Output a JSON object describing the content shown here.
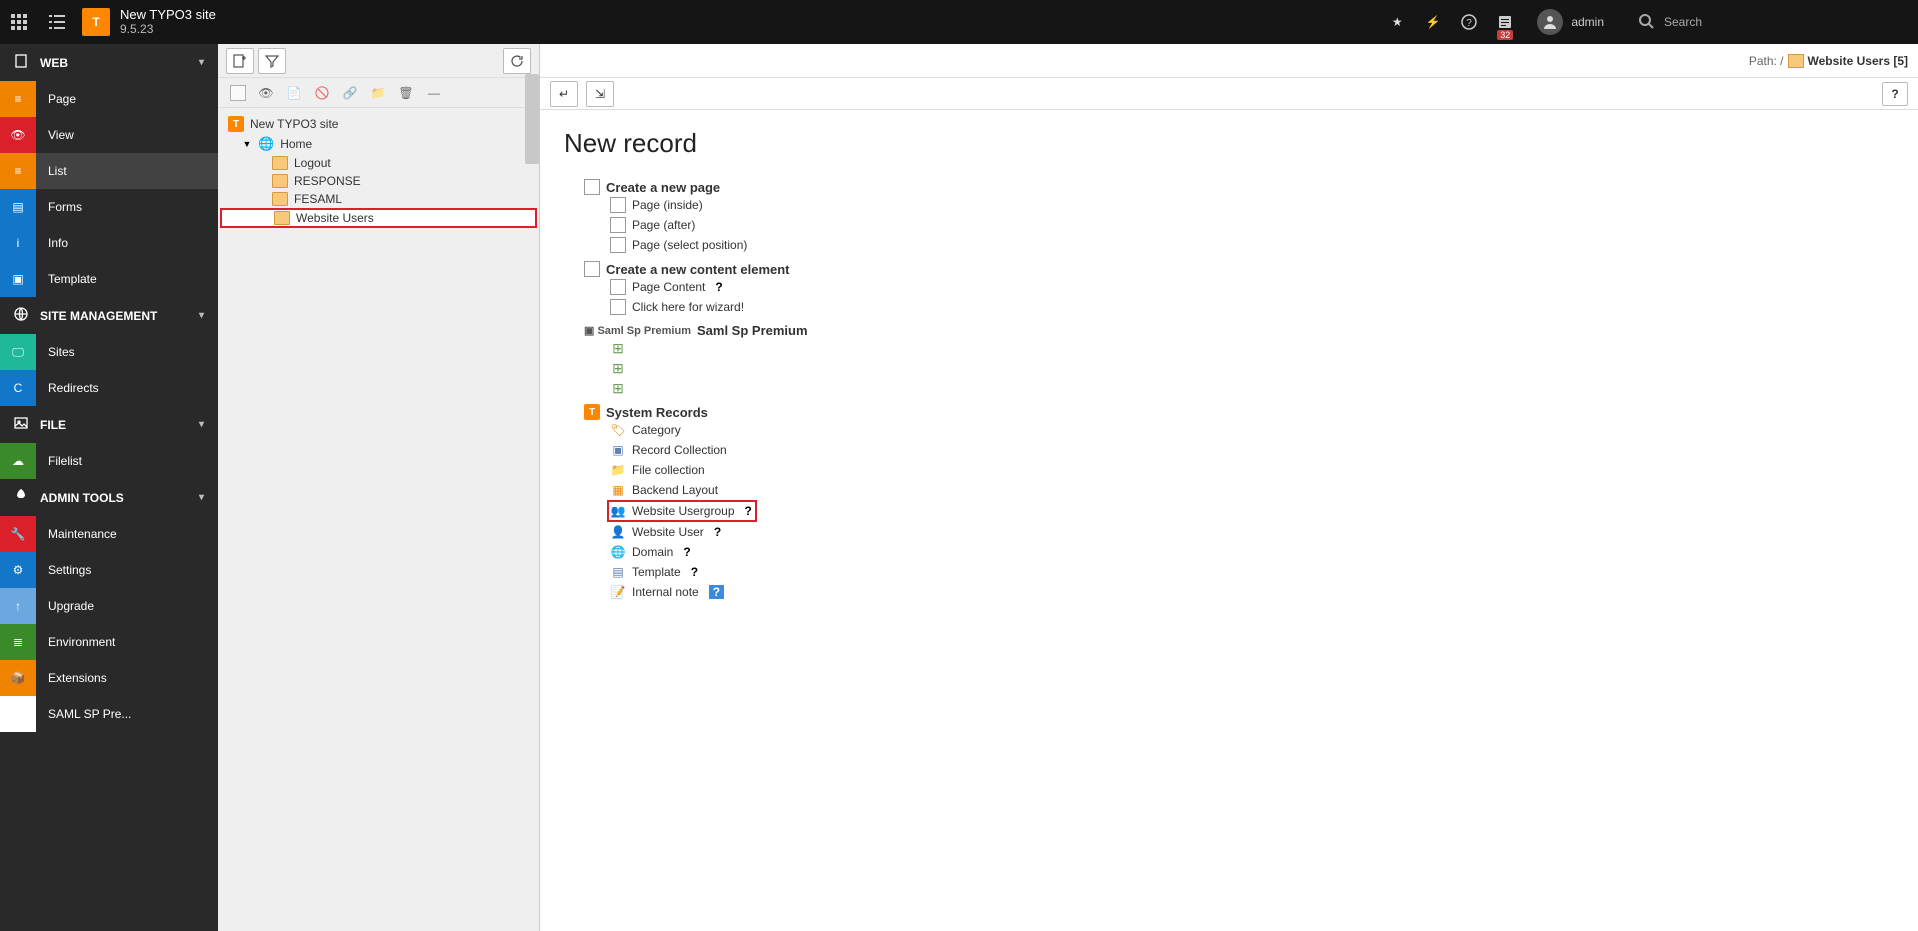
{
  "topbar": {
    "site_title": "New TYPO3 site",
    "version": "9.5.23",
    "notification_count": "32",
    "username": "admin",
    "search_label": "Search"
  },
  "modmenu": {
    "groups": [
      {
        "label": "WEB",
        "icon": "doc",
        "items": [
          {
            "label": "Page",
            "cls": "sq-page",
            "icon": "≡"
          },
          {
            "label": "View",
            "cls": "sq-view",
            "icon": "👁"
          },
          {
            "label": "List",
            "cls": "sq-list",
            "icon": "≡",
            "active": true
          },
          {
            "label": "Forms",
            "cls": "sq-forms",
            "icon": "▤"
          },
          {
            "label": "Info",
            "cls": "sq-info",
            "icon": "i"
          },
          {
            "label": "Template",
            "cls": "sq-template",
            "icon": "▣"
          }
        ]
      },
      {
        "label": "SITE MANAGEMENT",
        "icon": "globe",
        "items": [
          {
            "label": "Sites",
            "cls": "sq-sites",
            "icon": "🖵"
          },
          {
            "label": "Redirects",
            "cls": "sq-redirects",
            "icon": "C"
          }
        ]
      },
      {
        "label": "FILE",
        "icon": "image",
        "items": [
          {
            "label": "Filelist",
            "cls": "sq-filelist",
            "icon": "☁"
          }
        ]
      },
      {
        "label": "ADMIN TOOLS",
        "icon": "rocket",
        "items": [
          {
            "label": "Maintenance",
            "cls": "sq-maint",
            "icon": "🔧"
          },
          {
            "label": "Settings",
            "cls": "sq-settings",
            "icon": "⚙"
          },
          {
            "label": "Upgrade",
            "cls": "sq-upgrade",
            "icon": "↑"
          },
          {
            "label": "Environment",
            "cls": "sq-env",
            "icon": "≣"
          },
          {
            "label": "Extensions",
            "cls": "sq-ext",
            "icon": "📦"
          },
          {
            "label": "SAML SP Pre...",
            "cls": "sq-saml",
            "icon": "◐"
          }
        ]
      }
    ]
  },
  "pagetree": {
    "root": "New TYPO3 site",
    "home": "Home",
    "children": [
      {
        "label": "Logout"
      },
      {
        "label": "RESPONSE"
      },
      {
        "label": "FESAML"
      },
      {
        "label": "Website Users",
        "highlight": true
      }
    ]
  },
  "main": {
    "path_prefix": "Path: /",
    "path_label": "Website Users [5]",
    "heading": "New record",
    "tree": {
      "create_page": {
        "label": "Create a new page",
        "items": [
          {
            "label": "Page (inside)"
          },
          {
            "label": "Page (after)"
          },
          {
            "label": "Page (select position)"
          }
        ]
      },
      "create_content": {
        "label": "Create a new content element",
        "items": [
          {
            "label": "Page Content",
            "help": true
          },
          {
            "label": "Click here for wizard!"
          }
        ]
      },
      "saml": {
        "prefix": "Saml Sp Premium",
        "label": "Saml Sp Premium"
      },
      "system": {
        "label": "System Records",
        "items": [
          {
            "label": "Category",
            "icon": "tag"
          },
          {
            "label": "Record Collection",
            "icon": "collection"
          },
          {
            "label": "File collection",
            "icon": "file"
          },
          {
            "label": "Backend Layout",
            "icon": "layout"
          },
          {
            "label": "Website Usergroup",
            "icon": "ugroup",
            "help": true,
            "highlight": true
          },
          {
            "label": "Website User",
            "icon": "user",
            "help": true
          },
          {
            "label": "Domain",
            "icon": "globe2",
            "help": true
          },
          {
            "label": "Template",
            "icon": "tmpl",
            "help": true
          },
          {
            "label": "Internal note",
            "icon": "note",
            "help_hl": true
          }
        ]
      }
    }
  }
}
